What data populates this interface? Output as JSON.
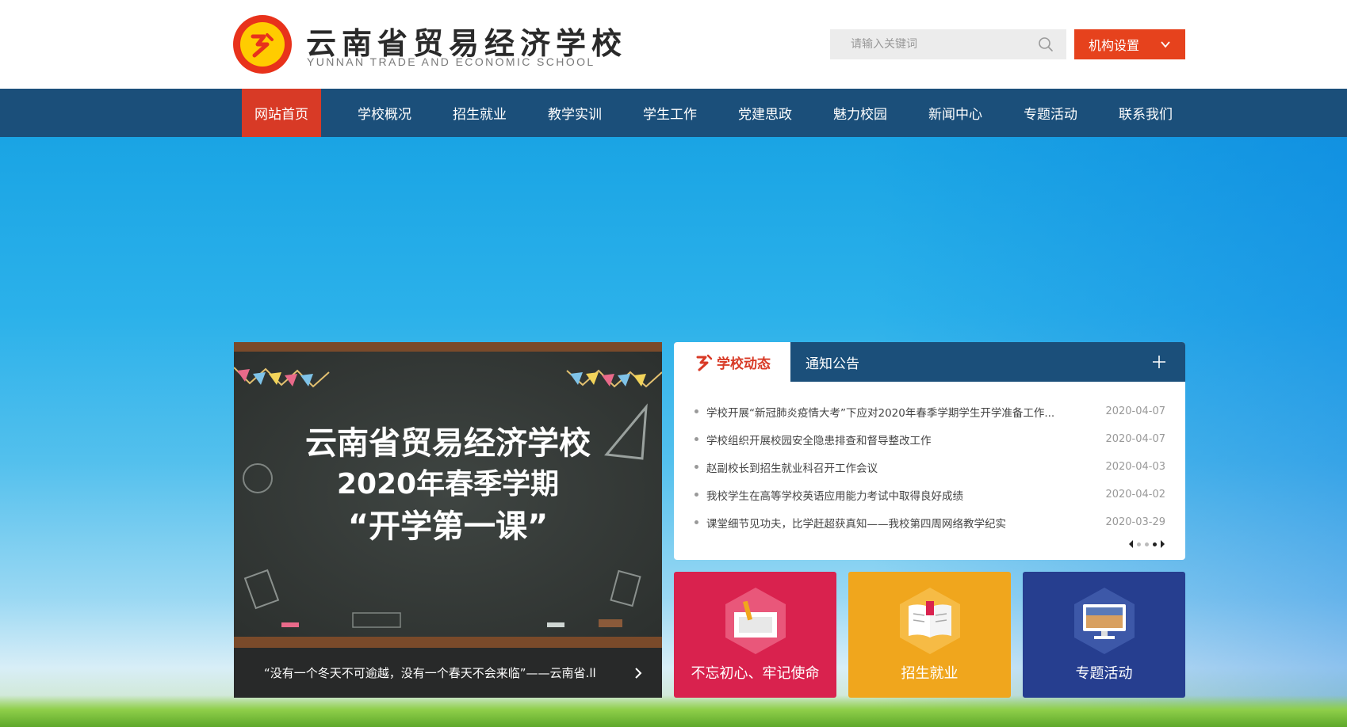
{
  "header": {
    "school_name": "云南省贸易经济学校",
    "school_name_en": "YUNNAN TRADE AND ECONOMIC SCHOOL",
    "search_placeholder": "请输入关键词",
    "org_button_label": "机构设置"
  },
  "nav": {
    "items": [
      {
        "label": "网站首页",
        "active": true
      },
      {
        "label": "学校概况"
      },
      {
        "label": "招生就业"
      },
      {
        "label": "教学实训"
      },
      {
        "label": "学生工作"
      },
      {
        "label": "党建思政"
      },
      {
        "label": "魅力校园"
      },
      {
        "label": "新闻中心"
      },
      {
        "label": "专题活动"
      },
      {
        "label": "联系我们"
      }
    ]
  },
  "slide": {
    "line1": "云南省贸易经济学校",
    "line2": "2020年春季学期",
    "line3": "“开学第一课”",
    "caption": "“没有一个冬天不可逾越，没有一个春天不会来临”——云南省.ll"
  },
  "news": {
    "tab_active": "学校动态",
    "tab_other": "通知公告",
    "items": [
      {
        "title": "学校开展“新冠肺炎疫情大考”下应对2020年春季学期学生开学准备工作...",
        "date": "2020-04-07"
      },
      {
        "title": "学校组织开展校园安全隐患排查和督导整改工作",
        "date": "2020-04-07"
      },
      {
        "title": "赵副校长到招生就业科召开工作会议",
        "date": "2020-04-03"
      },
      {
        "title": "我校学生在高等学校英语应用能力考试中取得良好成绩",
        "date": "2020-04-02"
      },
      {
        "title": "课堂细节见功夫，比学赶超获真知——我校第四周网络教学纪实",
        "date": "2020-03-29"
      }
    ]
  },
  "cards": [
    {
      "label": "不忘初心、牢记使命",
      "color": "#d9224e"
    },
    {
      "label": "招生就业",
      "color": "#f0a61d"
    },
    {
      "label": "专题活动",
      "color": "#263e8f"
    }
  ],
  "colors": {
    "nav_bg": "#1b4f7a",
    "accent_red": "#d83a26",
    "org_button": "#e6421d"
  }
}
